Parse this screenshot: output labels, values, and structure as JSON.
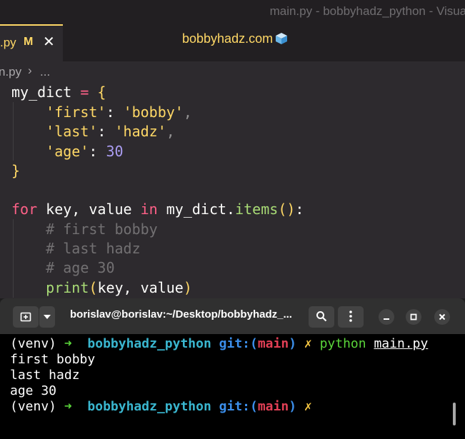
{
  "window": {
    "title": "main.py - bobbyhadz_python - Visual"
  },
  "tab": {
    "name": ".py",
    "modified": "M",
    "close": "✕"
  },
  "watermark": {
    "text": "bobbyhadz.com"
  },
  "breadcrumb": {
    "file": "n.py",
    "separator": "›",
    "ellipsis": "..."
  },
  "code": {
    "l1": {
      "name": "my_dict",
      "eq": " = ",
      "brace": "{"
    },
    "l2": {
      "key": "'first'",
      "colon": ": ",
      "val": "'bobby'",
      "comma": ","
    },
    "l3": {
      "key": "'last'",
      "colon": ": ",
      "val": "'hadz'",
      "comma": ","
    },
    "l4": {
      "key": "'age'",
      "colon": ": ",
      "val": "30"
    },
    "l5": {
      "brace": "}"
    },
    "l7": {
      "kw_for": "for",
      "vars": " key, value ",
      "kw_in": "in",
      "obj": " my_dict.",
      "method": "items",
      "paren": "()",
      "colon": ":"
    },
    "l8": {
      "comment": "# first bobby"
    },
    "l9": {
      "comment": "# last hadz"
    },
    "l10": {
      "comment": "# age 30"
    },
    "l11": {
      "fn": "print",
      "open": "(",
      "args": "key, value",
      "close": ")"
    }
  },
  "terminal": {
    "title": "borislav@borislav:~/Desktop/bobbyhadz_...",
    "venv": "(venv)",
    "arrow": "➜",
    "dir": "bobbyhadz_python",
    "git": "git:(",
    "branch": "main",
    "git_close": ")",
    "dirty": "✗",
    "command": "python",
    "argument": "main.py",
    "output": [
      "first bobby",
      "last hadz",
      "age 30"
    ]
  }
}
